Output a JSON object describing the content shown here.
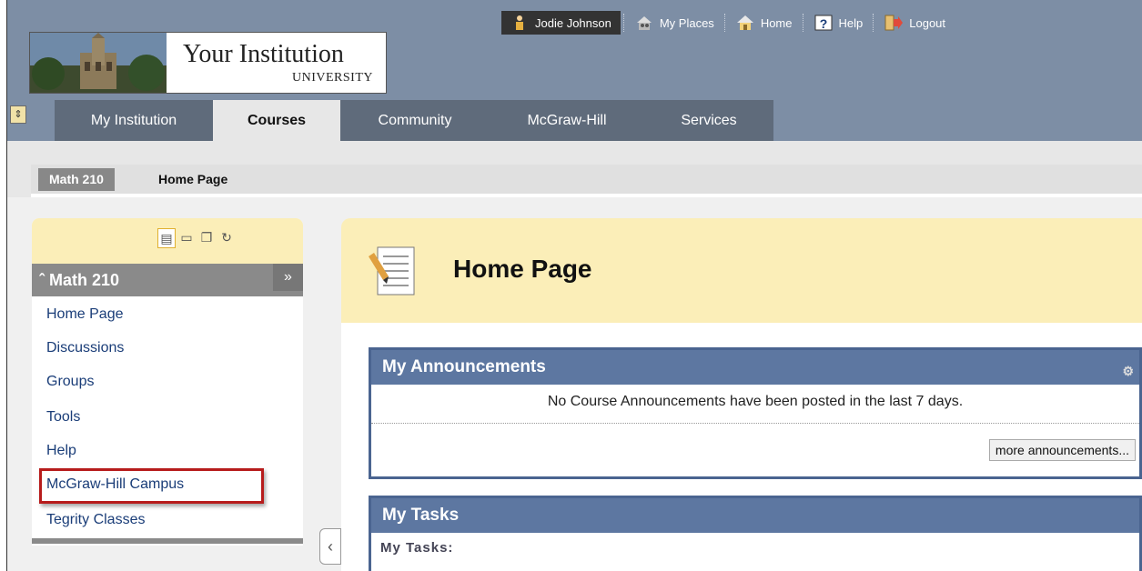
{
  "logo": {
    "name": "Your Institution",
    "subtitle": "UNIVERSITY"
  },
  "toplinks": {
    "user": "Jodie Johnson",
    "my_places": "My Places",
    "home": "Home",
    "help": "Help",
    "logout": "Logout"
  },
  "tabs": [
    "My Institution",
    "Courses",
    "Community",
    "McGraw-Hill",
    "Services"
  ],
  "breadcrumb": {
    "course": "Math 210",
    "page": "Home Page"
  },
  "nav": {
    "title": "Math 210",
    "items": [
      "Home Page",
      "Discussions",
      "Groups",
      "Tools",
      "Help",
      "McGraw-Hill Campus",
      "Tegrity Classes"
    ]
  },
  "page": {
    "title": "Home Page"
  },
  "announcements": {
    "title": "My Announcements",
    "message": "No Course Announcements have been posted in the last 7 days.",
    "more": "more announcements..."
  },
  "tasks": {
    "title": "My Tasks",
    "subtitle": "My Tasks:"
  },
  "colors": {
    "header": "#7d8ea5",
    "module_header": "#5d77a1",
    "highlight": "#b71c1c",
    "nav_toolbar": "#fbeeb8"
  }
}
